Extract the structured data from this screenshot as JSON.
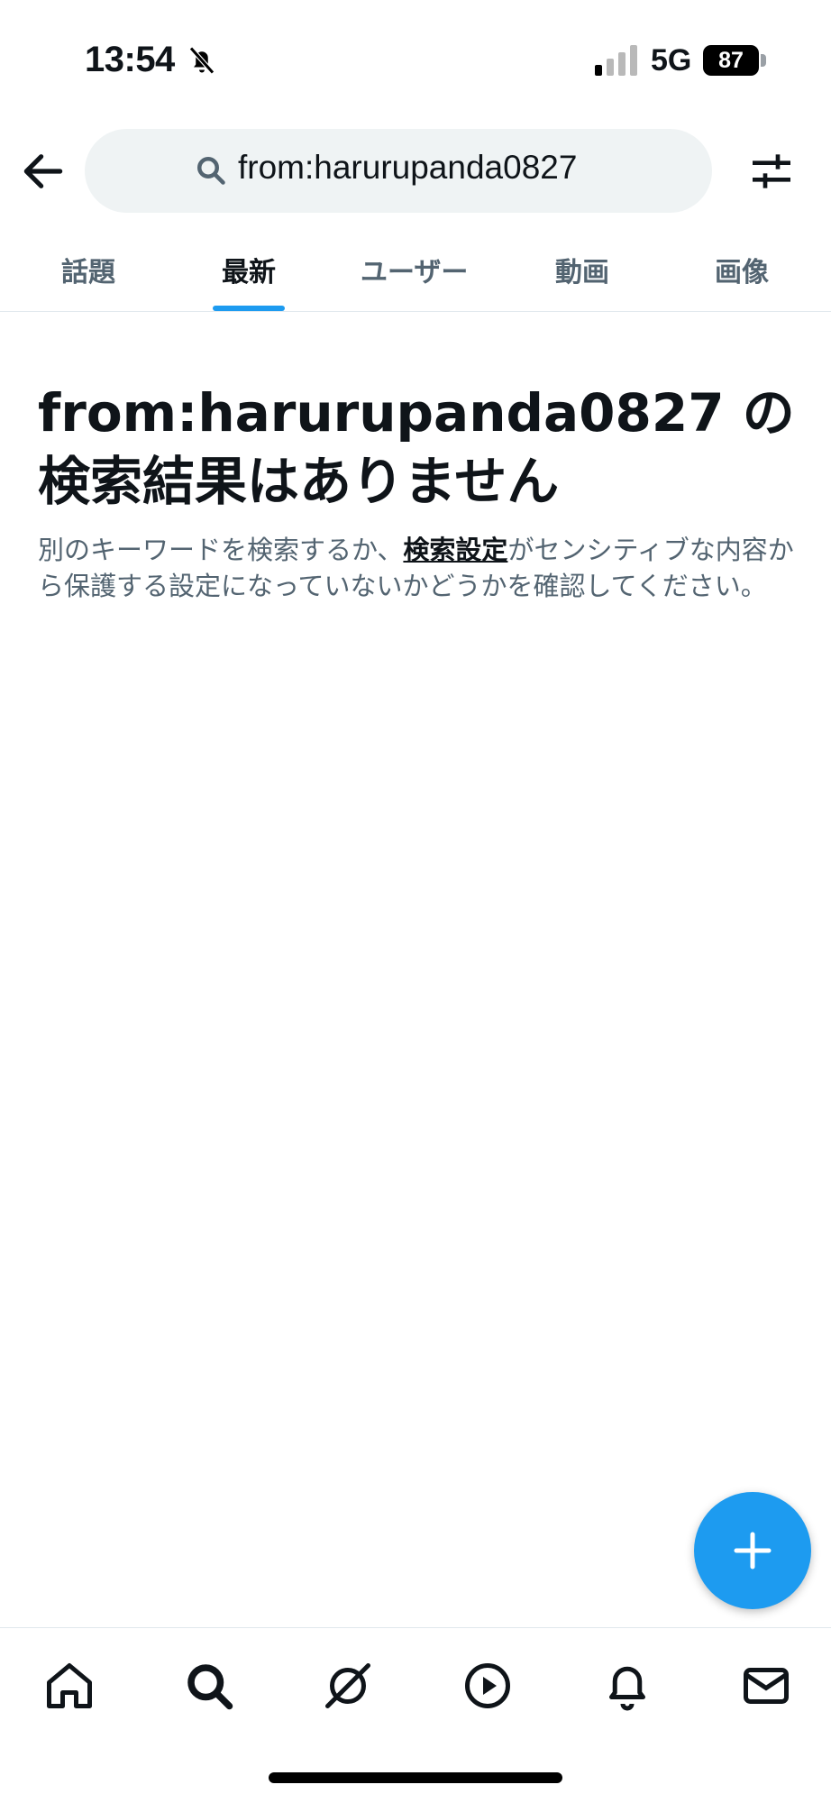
{
  "status": {
    "time": "13:54",
    "network": "5G",
    "battery": "87"
  },
  "search": {
    "query": "from:harurupanda0827"
  },
  "tabs": [
    {
      "label": "話題"
    },
    {
      "label": "最新"
    },
    {
      "label": "ユーザー"
    },
    {
      "label": "動画"
    },
    {
      "label": "画像"
    }
  ],
  "empty_state": {
    "title": "from:harurupanda0827 の検索結果はありません",
    "desc_before": "別のキーワードを検索するか、",
    "desc_link": "検索設定",
    "desc_after": "がセンシティブな内容から保護する設定になっていないかどうかを確認してください。"
  },
  "colors": {
    "accent": "#1d9bf0",
    "text": "#0f1419",
    "secondary": "#536471"
  },
  "icons": {
    "back": "arrow-left-icon",
    "search": "search-icon",
    "filter": "sliders-icon",
    "compose": "plus-icon",
    "nav": [
      "home-icon",
      "search-icon",
      "grok-icon",
      "video-icon",
      "bell-icon",
      "mail-icon"
    ]
  }
}
